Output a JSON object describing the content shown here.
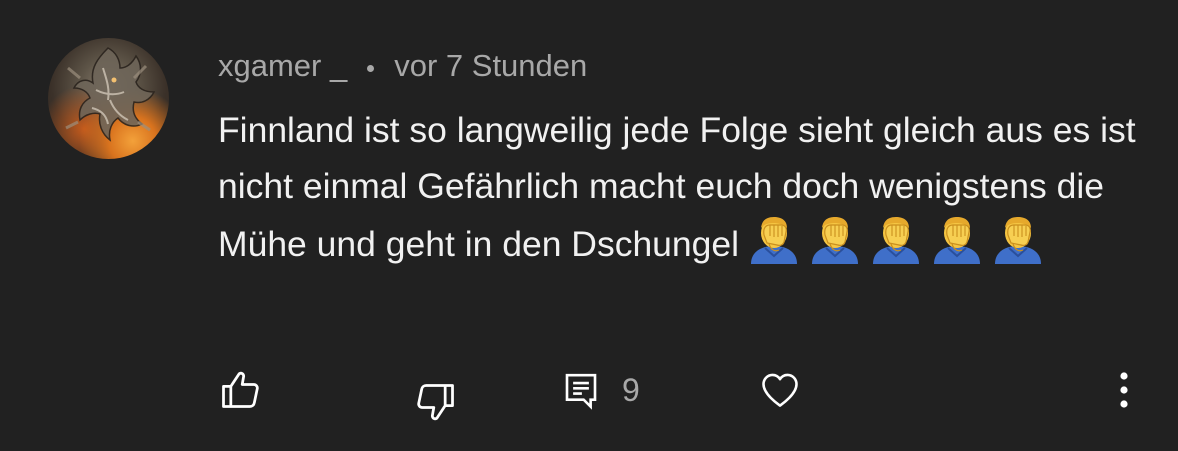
{
  "comment": {
    "author": "xgamer _",
    "timestamp": "vor 7 Stunden",
    "text": "Finnland ist so langweilig jede Folge sieht gleich aus es ist nicht einmal Gefährlich macht euch doch wenigstens die Mühe und geht in den Dschungel",
    "emoji": "face-palm (man)",
    "emoji_count": 5,
    "avatar_icon": "dragon-avatar-icon"
  },
  "actions": {
    "like_icon": "thumbs-up-icon",
    "dislike_icon": "thumbs-down-icon",
    "reply_icon": "reply-comment-icon",
    "reply_count": "9",
    "heart_icon": "heart-icon",
    "more_icon": "more-vertical-icon"
  },
  "colors": {
    "background": "#212121",
    "meta_text": "#a8a8a8",
    "body_text": "#f1f1f1",
    "icon": "#ffffff"
  }
}
